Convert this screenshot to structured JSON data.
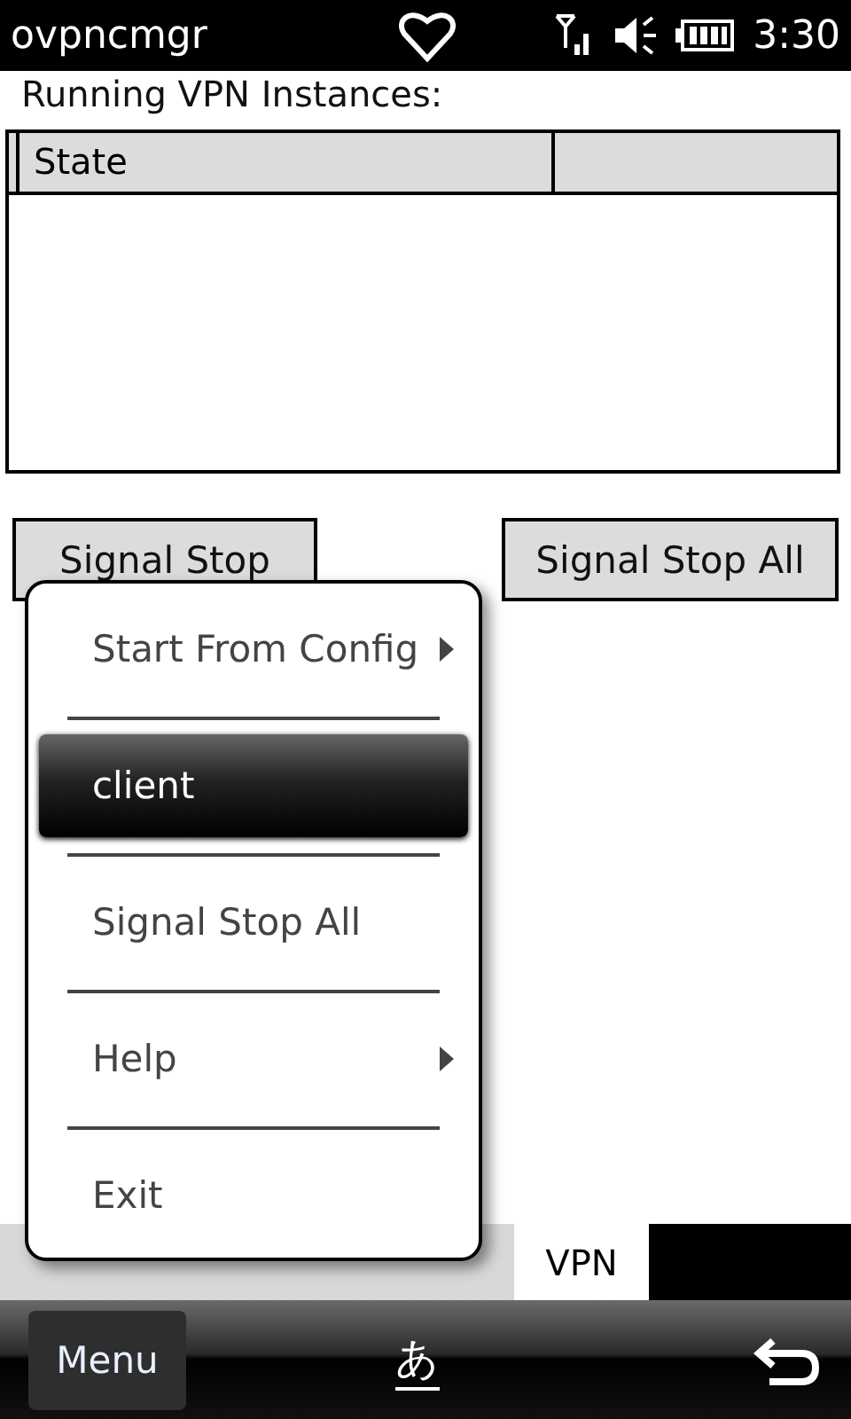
{
  "status_bar": {
    "title": "ovpncmgr",
    "time": "3:30"
  },
  "label": "Running VPN Instances:",
  "table": {
    "columns": [
      "State"
    ]
  },
  "buttons": [
    "Signal Stop",
    "Signal Stop All"
  ],
  "tabs": [
    {
      "label": "VPN",
      "selected": true
    }
  ],
  "menu": [
    {
      "label": "Start From Config",
      "submenu": true,
      "selected": false
    },
    {
      "label": "client",
      "submenu": false,
      "selected": true
    },
    {
      "label": "Signal Stop All",
      "submenu": false,
      "selected": false
    },
    {
      "label": "Help",
      "submenu": true,
      "selected": false
    },
    {
      "label": "Exit",
      "submenu": false,
      "selected": false
    }
  ],
  "softkeys": {
    "left": "Menu",
    "center": "あ"
  }
}
